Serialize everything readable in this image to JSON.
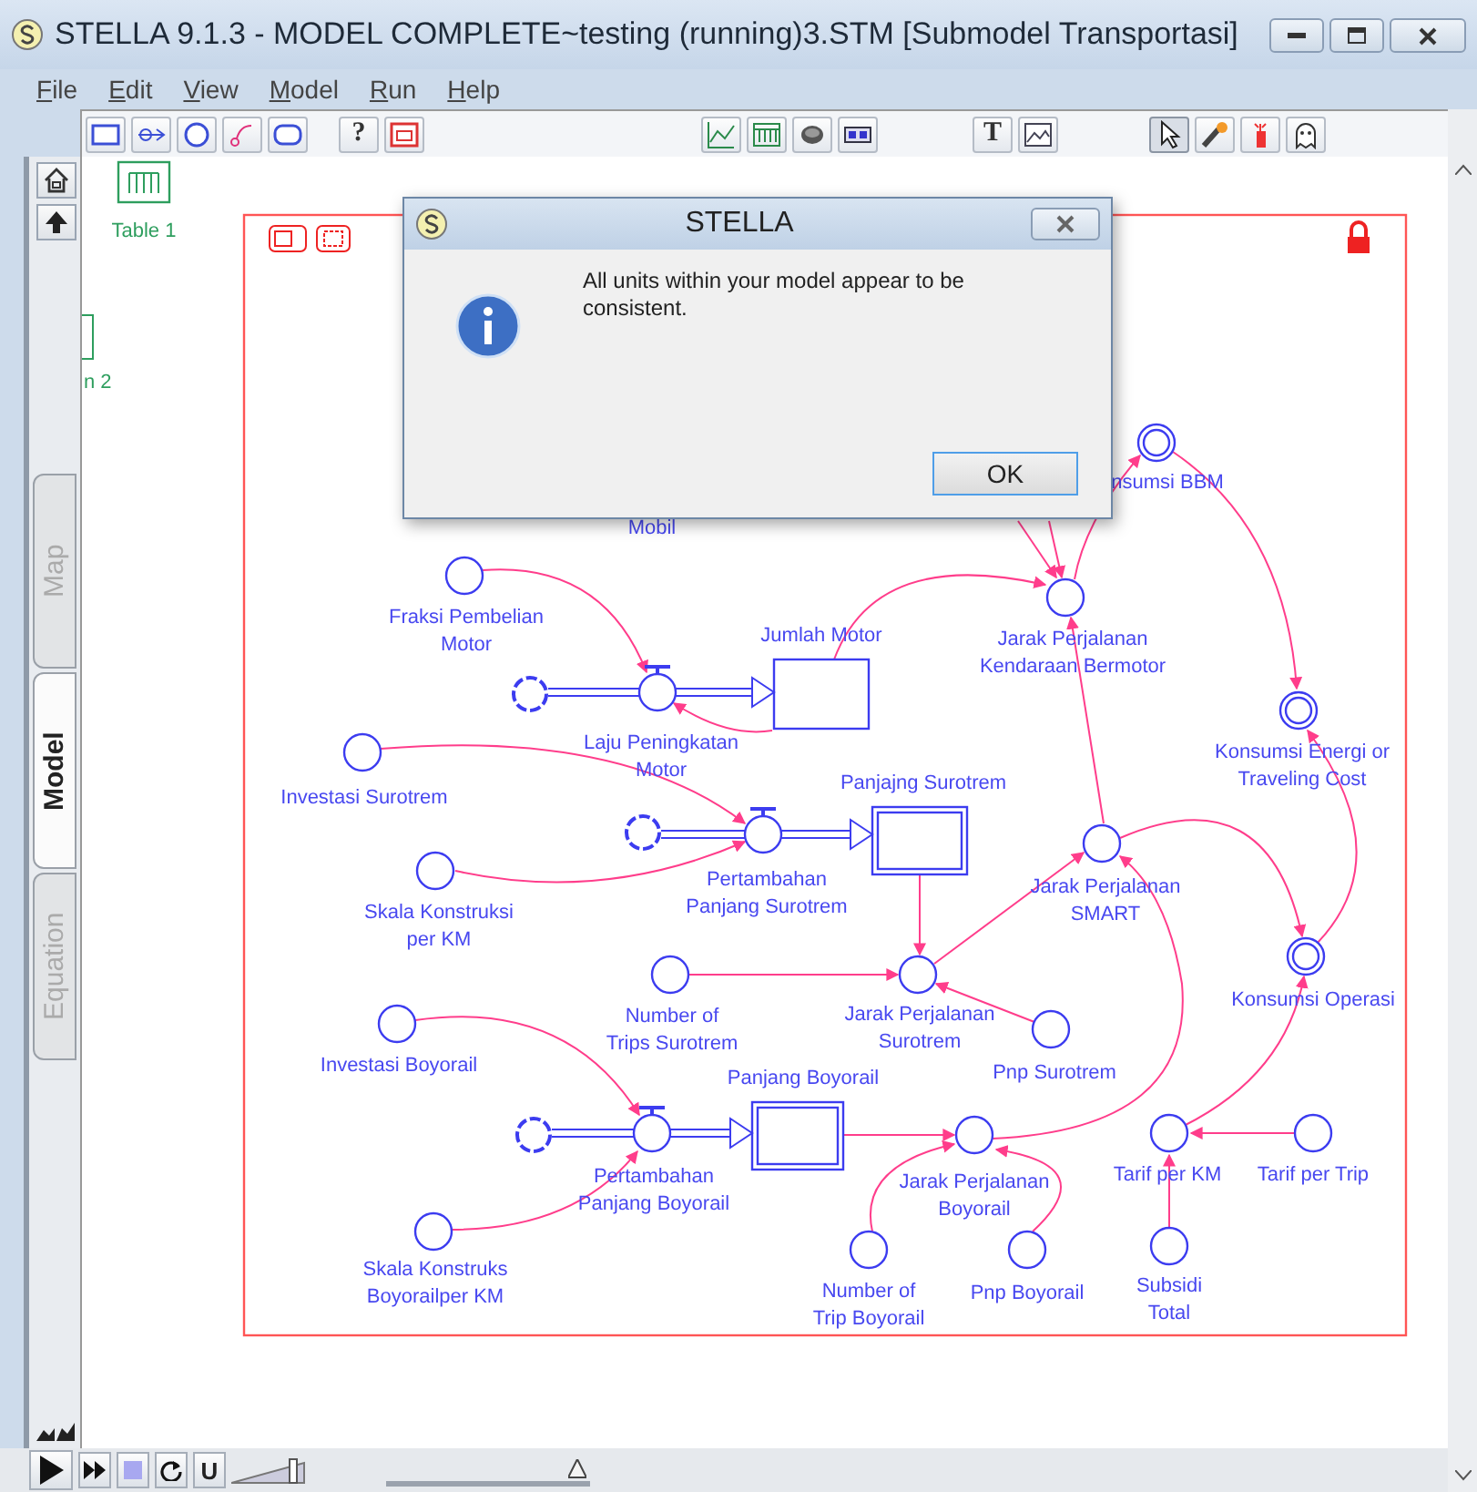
{
  "window": {
    "title": "STELLA 9.1.3 - MODEL COMPLETE~testing (running)3.STM [Submodel Transportasi]"
  },
  "menu": [
    "File",
    "Edit",
    "View",
    "Model",
    "Run",
    "Help"
  ],
  "toolbar": {
    "help_tool": "?",
    "text_tool": "T"
  },
  "side_tabs": [
    {
      "label": "Map",
      "selected": false
    },
    {
      "label": "Model",
      "selected": true
    },
    {
      "label": "Equation",
      "selected": false
    }
  ],
  "canvas": {
    "table_label": "Table 1",
    "cut_label": "n 2",
    "nodes": [
      {
        "kind": "label",
        "label": "Mobil"
      },
      {
        "kind": "double_converter",
        "label": "nsumsi BBM"
      },
      {
        "kind": "converter",
        "label": "Fraksi Pembelian\nMotor"
      },
      {
        "kind": "stock",
        "label": "Jumlah Motor"
      },
      {
        "kind": "converter",
        "label": "Jarak Perjalanan\nKendaraan Bermotor"
      },
      {
        "kind": "flow",
        "label": "Laju Peningkatan\nMotor"
      },
      {
        "kind": "double_converter",
        "label": "Konsumsi Energi or\nTraveling Cost"
      },
      {
        "kind": "converter",
        "label": "Investasi Surotrem"
      },
      {
        "kind": "double_stock",
        "label": "Panjajng Surotrem"
      },
      {
        "kind": "flow",
        "label": "Pertambahan\nPanjang Surotrem"
      },
      {
        "kind": "converter",
        "label": "Jarak Perjalanan\nSMART"
      },
      {
        "kind": "converter",
        "label": "Skala Konstruksi\nper KM"
      },
      {
        "kind": "double_converter",
        "label": "Konsumsi Operasi"
      },
      {
        "kind": "converter",
        "label": "Number of\nTrips Surotrem"
      },
      {
        "kind": "converter",
        "label": "Jarak Perjalanan\nSurotrem"
      },
      {
        "kind": "converter",
        "label": "Investasi Boyorail"
      },
      {
        "kind": "double_stock",
        "label": "Panjang Boyorail"
      },
      {
        "kind": "converter",
        "label": "Pnp Surotrem"
      },
      {
        "kind": "flow",
        "label": "Pertambahan\nPanjang Boyorail"
      },
      {
        "kind": "converter",
        "label": "Jarak Perjalanan\nBoyorail"
      },
      {
        "kind": "converter",
        "label": "Tarif per KM"
      },
      {
        "kind": "converter",
        "label": "Tarif per Trip"
      },
      {
        "kind": "converter",
        "label": "Skala Konstruks\nBoyorailper KM"
      },
      {
        "kind": "converter",
        "label": "Number of\nTrip Boyorail"
      },
      {
        "kind": "converter",
        "label": "Pnp Boyorail"
      },
      {
        "kind": "converter",
        "label": "Subsidi\nTotal"
      }
    ]
  },
  "dialog": {
    "title": "STELLA",
    "message": "All units within your model appear to be consistent.",
    "button": "OK"
  },
  "run_controls": {
    "unit_button": "U",
    "speed": {
      "level": 0.94
    }
  }
}
